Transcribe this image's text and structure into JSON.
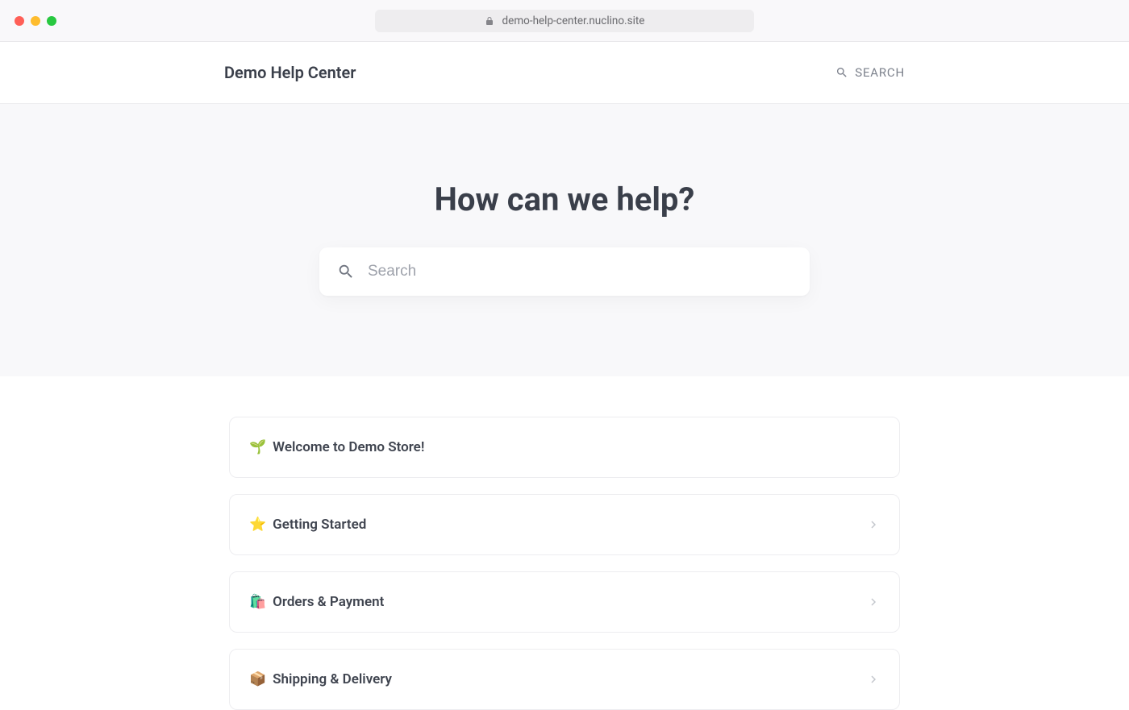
{
  "browser": {
    "url": "demo-help-center.nuclino.site"
  },
  "header": {
    "site_title": "Demo Help Center",
    "search_label": "SEARCH"
  },
  "hero": {
    "title": "How can we help?",
    "search_placeholder": "Search"
  },
  "categories": [
    {
      "emoji": "🌱",
      "label": "Welcome to Demo Store!",
      "has_chevron": false
    },
    {
      "emoji": "⭐",
      "label": "Getting Started",
      "has_chevron": true
    },
    {
      "emoji": "🛍️",
      "label": "Orders & Payment",
      "has_chevron": true
    },
    {
      "emoji": "📦",
      "label": "Shipping & Delivery",
      "has_chevron": true
    }
  ]
}
